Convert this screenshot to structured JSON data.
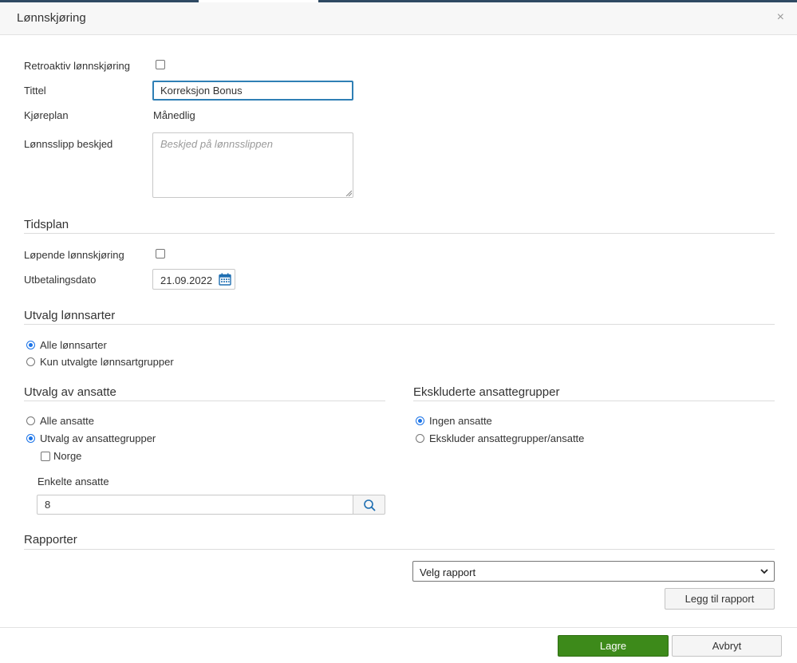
{
  "dialog": {
    "title": "Lønnskjøring",
    "close_glyph": "×"
  },
  "form": {
    "retroactive_label": "Retroaktiv lønnskjøring",
    "retroactive_checked": false,
    "title_label": "Tittel",
    "title_value": "Korreksjon Bonus",
    "schedule_label": "Kjøreplan",
    "schedule_value": "Månedlig",
    "payslip_label": "Lønnsslipp beskjed",
    "payslip_placeholder": "Beskjed på lønnsslippen"
  },
  "timeplan": {
    "section_title": "Tidsplan",
    "running_label": "Løpende lønnskjøring",
    "running_checked": false,
    "payment_date_label": "Utbetalingsdato",
    "payment_date_value": "21.09.2022",
    "calendar_icon": "calendar-icon"
  },
  "wage_types": {
    "section_title": "Utvalg lønnsarter",
    "options": [
      {
        "label": "Alle lønnsarter",
        "checked": true
      },
      {
        "label": "Kun utvalgte lønnsartgrupper",
        "checked": false
      }
    ]
  },
  "employees": {
    "section_title": "Utvalg av ansatte",
    "options": [
      {
        "label": "Alle ansatte",
        "checked": false
      },
      {
        "label": "Utvalg av ansattegrupper",
        "checked": true
      }
    ],
    "groups": [
      {
        "label": "Norge",
        "checked": false
      }
    ],
    "individual_label": "Enkelte ansatte",
    "individual_value": "8",
    "search_icon": "search-icon"
  },
  "excluded": {
    "section_title": "Ekskluderte ansattegrupper",
    "options": [
      {
        "label": "Ingen ansatte",
        "checked": true
      },
      {
        "label": "Ekskluder ansattegrupper/ansatte",
        "checked": false
      }
    ]
  },
  "reports": {
    "section_title": "Rapporter",
    "select_value": "Velg rapport",
    "add_button": "Legg til rapport"
  },
  "footer": {
    "save_button": "Lagre",
    "cancel_button": "Avbryt"
  },
  "colors": {
    "accent": "#1a73e8",
    "focus_border": "#2f7fb5",
    "primary_button": "#3d8a1a",
    "header_bg": "#f7f7f7"
  }
}
